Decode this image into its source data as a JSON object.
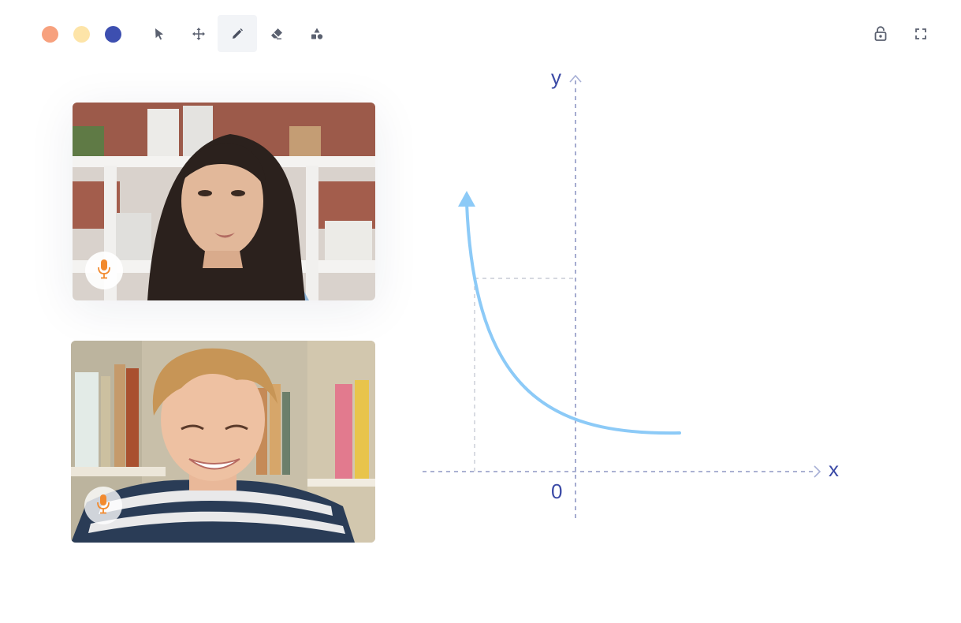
{
  "toolbar": {
    "colors": [
      {
        "name": "salmon",
        "hex": "#f7a17e"
      },
      {
        "name": "yellow",
        "hex": "#fde4a8"
      },
      {
        "name": "blue",
        "hex": "#3d4fb0"
      }
    ],
    "tools": [
      {
        "icon": "pointer-icon",
        "active": false
      },
      {
        "icon": "move-icon",
        "active": false
      },
      {
        "icon": "pencil-icon",
        "active": true
      },
      {
        "icon": "eraser-icon",
        "active": false
      },
      {
        "icon": "shapes-icon",
        "active": false
      }
    ],
    "right_icons": [
      "unlock-icon",
      "fullscreen-icon"
    ]
  },
  "participants": [
    {
      "mic_icon": "microphone-icon",
      "mic_color": "#f28a2e"
    },
    {
      "mic_icon": "microphone-icon",
      "mic_color": "#f28a2e"
    }
  ],
  "graph": {
    "x_label": "x",
    "y_label": "y",
    "origin_label": "0",
    "curve_color": "#8ccaf7",
    "axis_color": "#8f97c4"
  }
}
